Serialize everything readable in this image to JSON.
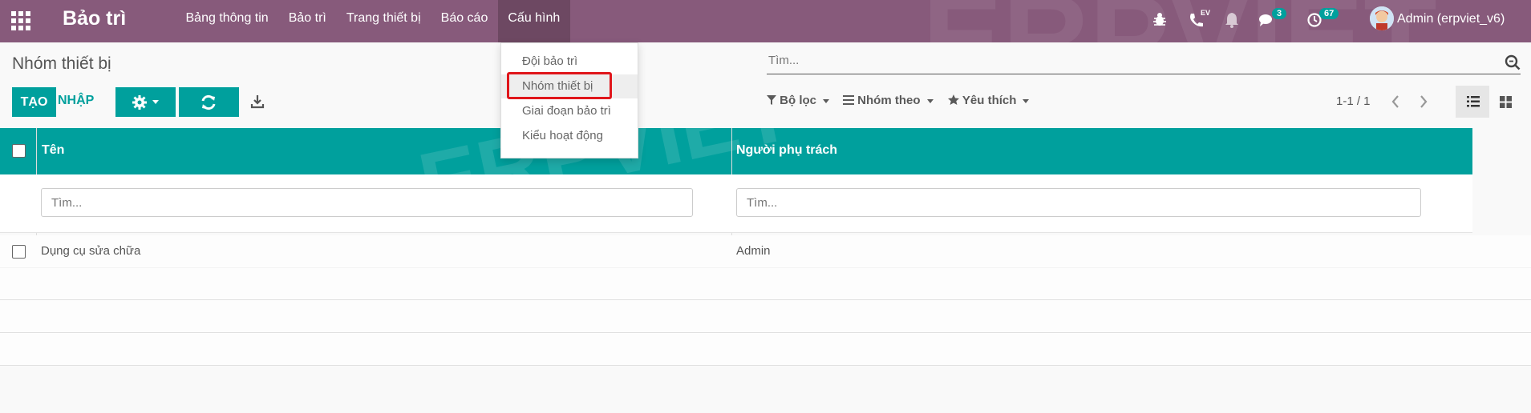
{
  "navbar": {
    "brand": "Bảo trì",
    "menu": [
      "Bảng thông tin",
      "Bảo trì",
      "Trang thiết bị",
      "Báo cáo",
      "Cấu hình"
    ],
    "active_menu": "Cấu hình",
    "phone_label": "EV",
    "messages_count": "3",
    "activities_count": "67",
    "user": "Admin (erpviet_v6)"
  },
  "dropdown": {
    "items": [
      "Đội bảo trì",
      "Nhóm thiết bị",
      "Giai đoạn bảo trì",
      "Kiểu hoạt động"
    ],
    "highlighted": "Nhóm thiết bị"
  },
  "control_panel": {
    "title": "Nhóm thiết bị",
    "create_label": "TẠO",
    "import_label": "NHẬP",
    "search_placeholder": "Tìm...",
    "filter_label": "Bộ lọc",
    "group_label": "Nhóm theo",
    "favorite_label": "Yêu thích",
    "pager": "1-1 / 1"
  },
  "table": {
    "columns": [
      "Tên",
      "Người phụ trách"
    ],
    "filter_placeholders": [
      "Tìm...",
      "Tìm..."
    ],
    "rows": [
      {
        "name": "Dụng cụ sửa chữa",
        "owner": "Admin"
      }
    ]
  },
  "watermark": "ERPVIET",
  "colors": {
    "navbar": "#875a7b",
    "accent": "#00a09d",
    "highlight": "#e0161b"
  }
}
